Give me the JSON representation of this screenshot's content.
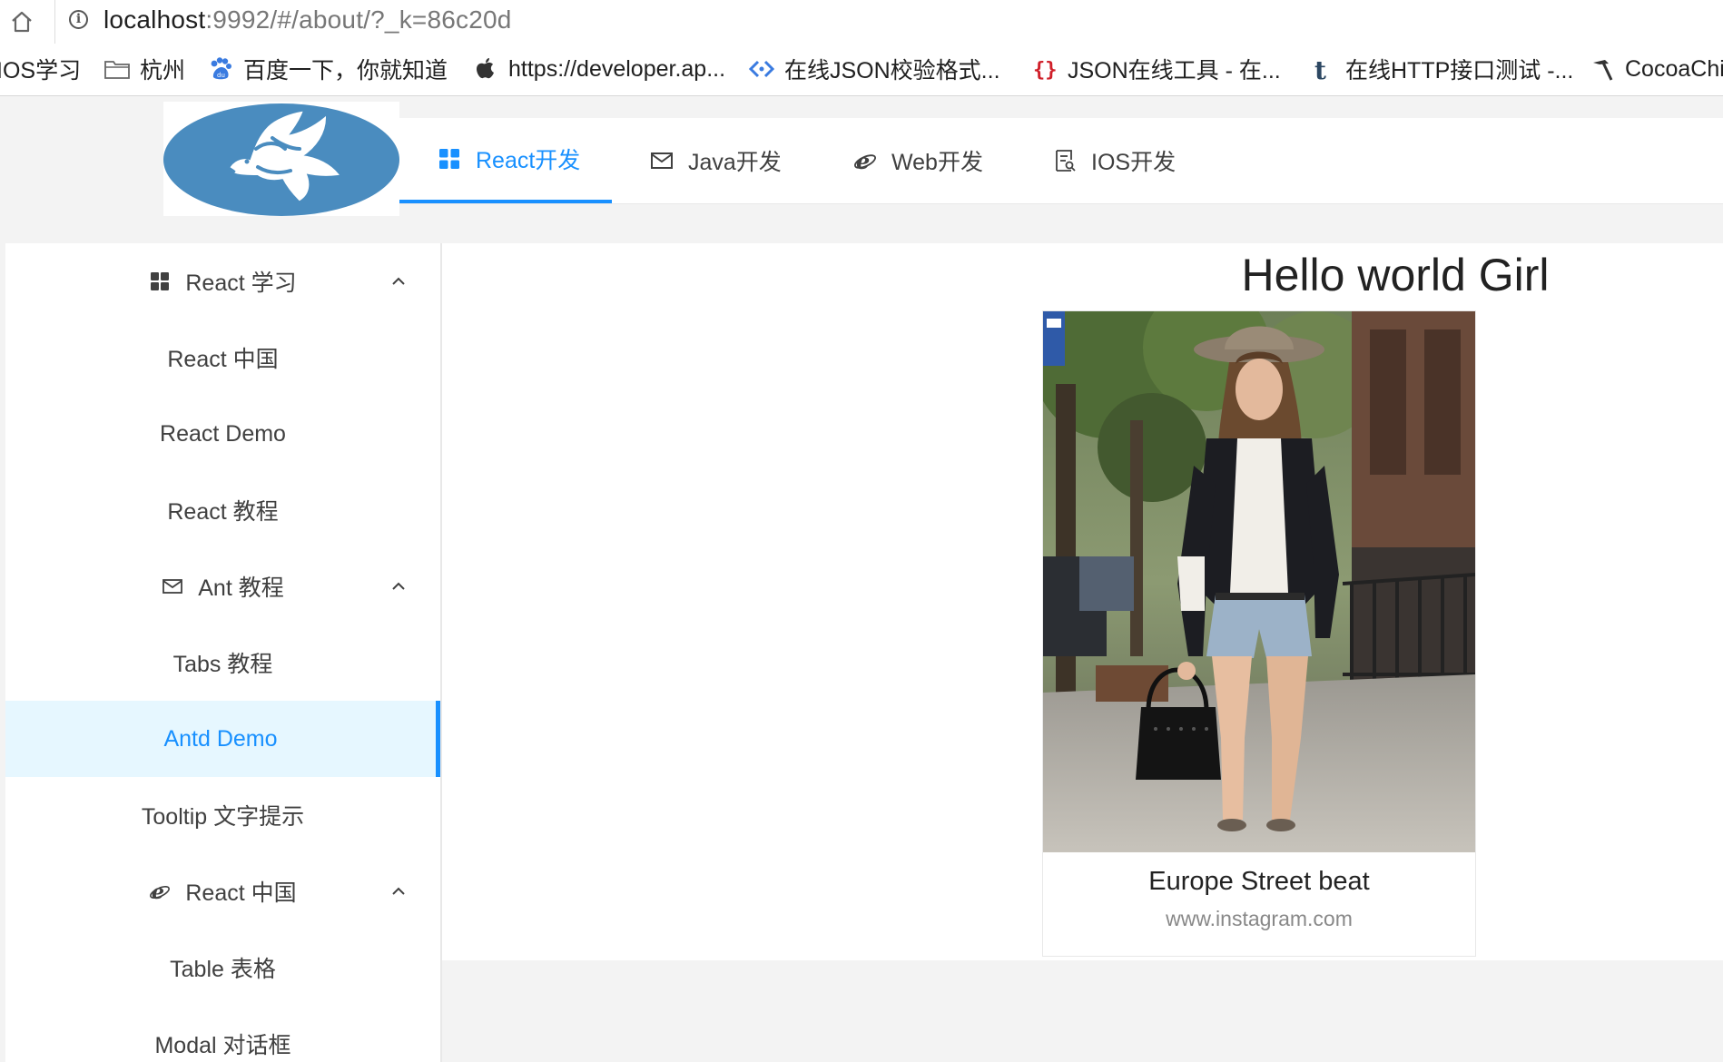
{
  "browser": {
    "url_host": "localhost",
    "url_rest": ":9992/#/about/?_k=86c20d",
    "bookmarks": [
      {
        "label": "IOS学习",
        "icon": "none"
      },
      {
        "label": "杭州",
        "icon": "folder-icon"
      },
      {
        "label": "百度一下，你就知道",
        "icon": "baidu-paw-icon"
      },
      {
        "label": "https://developer.ap...",
        "icon": "apple-icon"
      },
      {
        "label": "在线JSON校验格式...",
        "icon": "code-arrows-icon"
      },
      {
        "label": "JSON在线工具 - 在...",
        "icon": "braces-icon"
      },
      {
        "label": "在线HTTP接口测试 -...",
        "icon": "tumblr-t-icon"
      },
      {
        "label": "CocoaChi",
        "icon": "hammer-icon"
      }
    ]
  },
  "header": {
    "logo": "dove-logo",
    "nav": [
      {
        "label": "React开发",
        "icon": "appstore-icon",
        "active": true
      },
      {
        "label": "Java开发",
        "icon": "mail-icon",
        "active": false
      },
      {
        "label": "Web开发",
        "icon": "ie-icon",
        "active": false
      },
      {
        "label": "IOS开发",
        "icon": "solution-icon",
        "active": false
      }
    ]
  },
  "sidebar": {
    "groups": [
      {
        "title": "React 学习",
        "icon": "appstore-icon",
        "items": [
          "React 中国",
          "React Demo",
          "React 教程"
        ]
      },
      {
        "title": "Ant 教程",
        "icon": "mail-icon",
        "items": [
          "Tabs 教程",
          "Antd Demo",
          "Tooltip 文字提示"
        ]
      },
      {
        "title": "React 中国",
        "icon": "ie-icon",
        "items": [
          "Table 表格",
          "Modal 对话框"
        ]
      }
    ],
    "selected": "Antd Demo"
  },
  "content": {
    "title": "Hello world Girl",
    "card": {
      "title": "Europe Street beat",
      "description": "www.instagram.com"
    }
  },
  "colors": {
    "primary": "#1890ff",
    "selected_bg": "#e6f7ff",
    "logo_blue": "#4a8cbf"
  }
}
